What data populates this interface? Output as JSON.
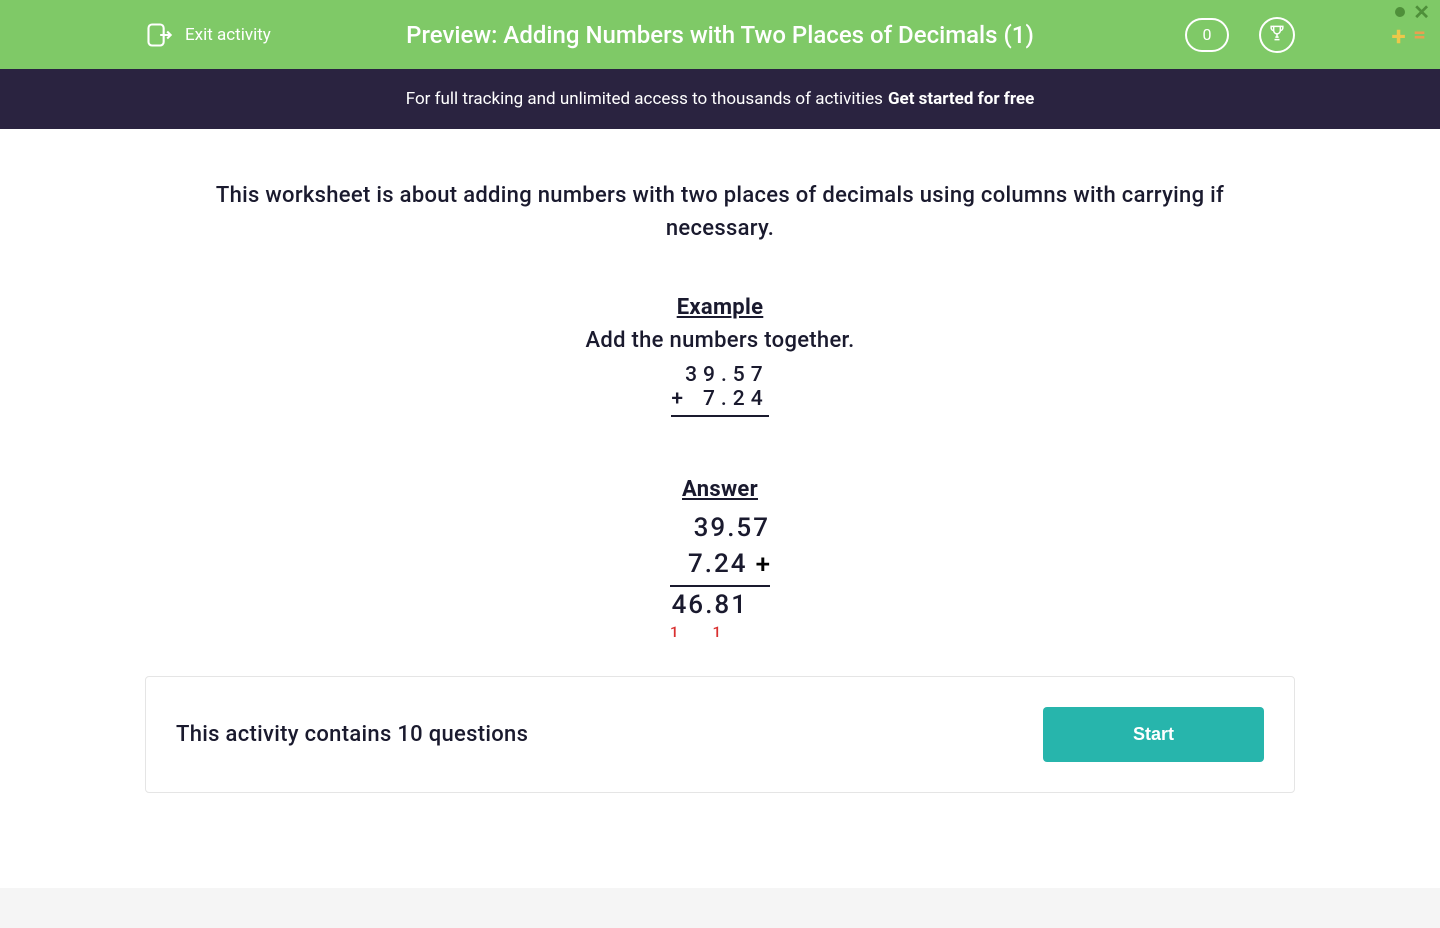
{
  "header": {
    "exit_label": "Exit activity",
    "title": "Preview: Adding Numbers with Two Places of Decimals (1)",
    "score": "0"
  },
  "promo": {
    "text": "For full tracking and unlimited access to thousands of activities",
    "link": "Get started for free"
  },
  "intro": "This worksheet is about adding numbers with two places of decimals using columns with carrying if necessary.",
  "example": {
    "heading": "Example",
    "instruction": "Add the numbers together.",
    "operator": "+",
    "num1": "39.57",
    "num2": "7.24"
  },
  "answer": {
    "heading": "Answer",
    "line1": "39.57",
    "line2": "7.24",
    "operator": "+",
    "result": "46.81",
    "carry1": "1",
    "carry2": "1"
  },
  "activity": {
    "text": "This activity contains 10 questions",
    "button": "Start"
  }
}
